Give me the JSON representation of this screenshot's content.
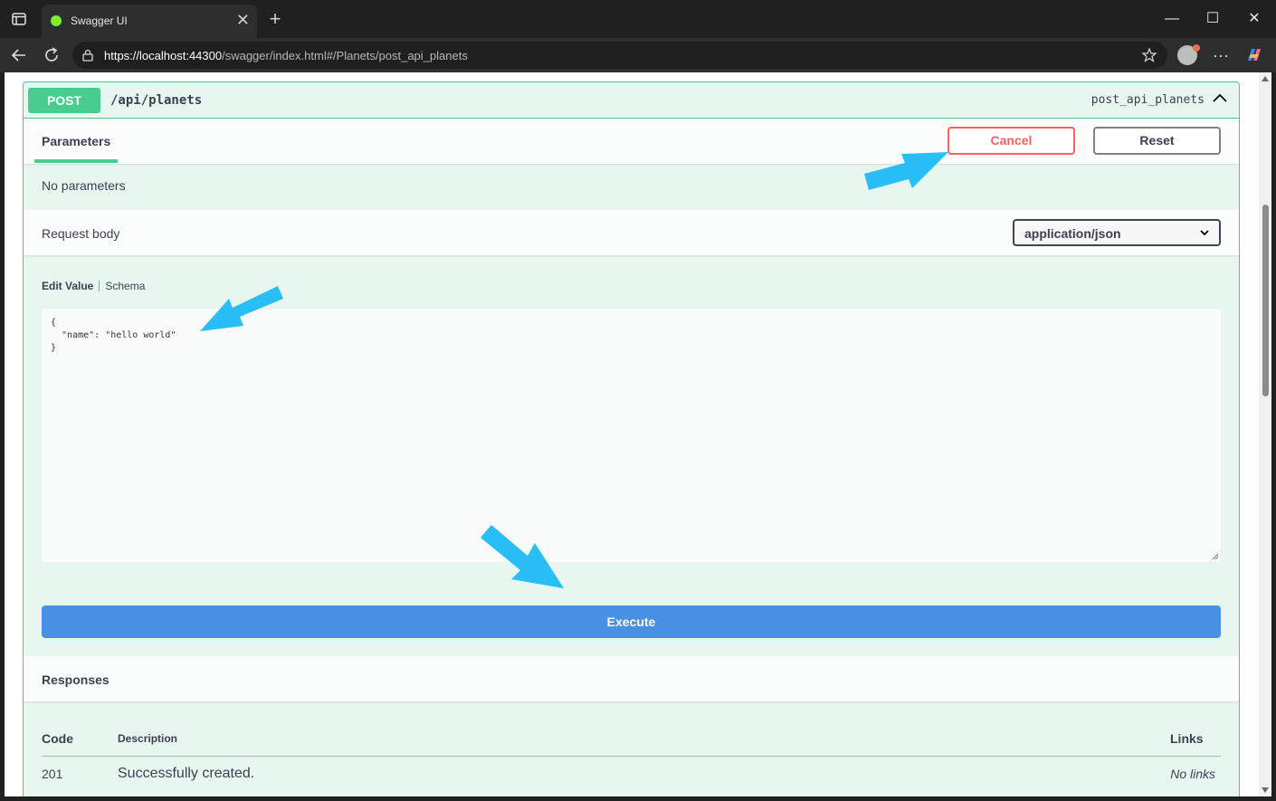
{
  "browser": {
    "tab_title": "Swagger UI",
    "tab_close": "✕",
    "new_tab": "+",
    "url_host": "https://localhost:44300",
    "url_path": "/swagger/index.html#/Planets/post_api_planets",
    "menu_label": "···",
    "window_controls": {
      "minimize": "—",
      "maximize": "☐",
      "close": "✕"
    }
  },
  "operation": {
    "method": "POST",
    "path": "/api/planets",
    "operation_id": "post_api_planets",
    "method_color": "#49cc90"
  },
  "parameters": {
    "tab_label": "Parameters",
    "cancel_label": "Cancel",
    "reset_label": "Reset",
    "empty_text": "No parameters"
  },
  "request_body": {
    "label": "Request body",
    "content_type": "application/json",
    "edit_tab": "Edit Value",
    "schema_tab": "Schema",
    "value": "{\n  \"name\": \"hello world\"\n}"
  },
  "execute_label": "Execute",
  "execute_color": "#4990e2",
  "responses": {
    "title": "Responses",
    "columns": {
      "code": "Code",
      "description": "Description",
      "links": "Links"
    },
    "rows": [
      {
        "code": "201",
        "description": "Successfully created.",
        "links": "No links"
      }
    ]
  },
  "icons": [
    "sidebar-icon",
    "swagger-favicon",
    "back-icon",
    "refresh-icon",
    "lock-icon",
    "star-icon",
    "profile-icon",
    "more-icon",
    "copilot-icon",
    "chevron-up-icon",
    "chevron-down-icon"
  ],
  "annotation_color": "#29bff6"
}
